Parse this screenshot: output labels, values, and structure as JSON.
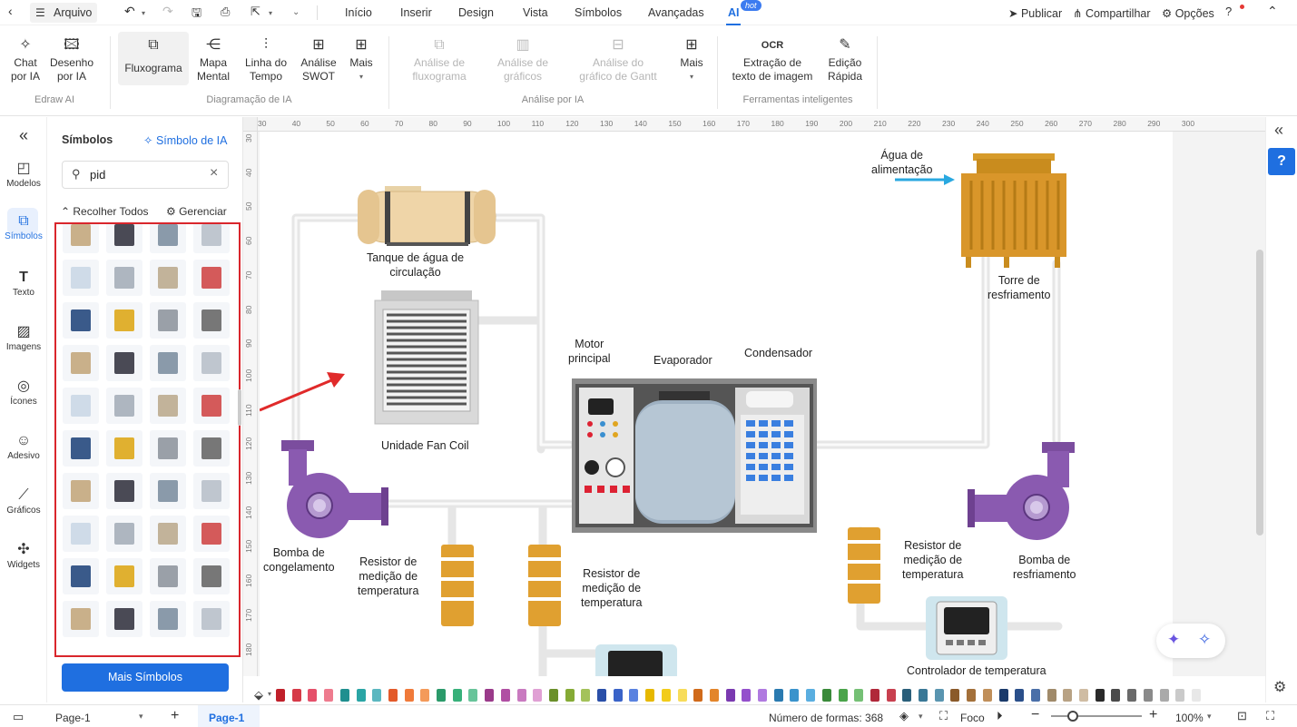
{
  "menubar": {
    "file": "Arquivo",
    "tabs": [
      "Início",
      "Inserir",
      "Design",
      "Vista",
      "Símbolos",
      "Avançadas"
    ],
    "ai_tab": "AI",
    "hot": "hot",
    "publish": "Publicar",
    "share": "Compartilhar",
    "options": "Opções"
  },
  "ribbon": {
    "chat": "Chat\npor IA",
    "drawing": "Desenho\npor IA",
    "flowchart": "Fluxograma",
    "mindmap": "Mapa\nMental",
    "timeline": "Linha do\nTempo",
    "swot": "Análise\nSWOT",
    "more1": "Mais",
    "an_flow": "Análise de\nfluxograma",
    "an_chart": "Análise de\ngráficos",
    "an_gantt": "Análise do\ngráfico de Gantt",
    "more2": "Mais",
    "ocr": "Extração de\ntexto de imagem",
    "quick_edit": "Edição\nRápida",
    "groups": [
      "Edraw AI",
      "Diagramação de IA",
      "Análise por IA",
      "Ferramentas inteligentes"
    ]
  },
  "leftnav": [
    "Modelos",
    "Símbolos",
    "Texto",
    "Imagens",
    "Ícones",
    "Adesivo",
    "Gráficos",
    "Widgets"
  ],
  "panel": {
    "title": "Símbolos",
    "ai_symbol": "Símbolo de IA",
    "search_value": "pid",
    "collapse": "Recolher Todos",
    "manage": "Gerenciar",
    "more_symbols": "Mais Símbolos"
  },
  "ruler": {
    "h": [
      "30",
      "40",
      "50",
      "60",
      "70",
      "80",
      "90",
      "100",
      "110",
      "120",
      "130",
      "140",
      "150",
      "160",
      "170",
      "180",
      "190",
      "200",
      "210",
      "220",
      "230",
      "240",
      "250",
      "260",
      "270",
      "280",
      "290",
      "300"
    ],
    "v": [
      "30",
      "40",
      "50",
      "60",
      "70",
      "80",
      "90",
      "100",
      "110",
      "120",
      "130",
      "140",
      "150",
      "160",
      "170",
      "180"
    ]
  },
  "diagram": {
    "tank": "Tanque de água de\ncirculação",
    "fancoil": "Unidade Fan Coil",
    "motor": "Motor\nprincipal",
    "evaporator": "Evaporador",
    "condenser": "Condensador",
    "feed": "Água de\nalimentação",
    "tower": "Torre de\nresfriamento",
    "pump_freeze": "Bomba de\ncongelamento",
    "resistor": "Resistor de\nmedição de\ntemperatura",
    "pump_cool": "Bomba de\nresfriamento",
    "controller": "Controlador de temperatura"
  },
  "colors": [
    "#c0202a",
    "#d63a48",
    "#e5506a",
    "#ee7b8e",
    "#1f8f8f",
    "#2aa5a5",
    "#5bb7c0",
    "#e35a2a",
    "#f07a3a",
    "#f49a5a",
    "#2b9a6a",
    "#37b07a",
    "#68c49a",
    "#9a3a8a",
    "#b04fa3",
    "#c97ac0",
    "#e0a0d4",
    "#6a8f2a",
    "#85aa35",
    "#a4c25a",
    "#2a4fa8",
    "#3a63c8",
    "#5a82e0",
    "#e6b800",
    "#f2cc1a",
    "#f7dc5a",
    "#d06a1a",
    "#e3852a",
    "#7a3ab0",
    "#9450cc",
    "#b07ae0",
    "#2a7ab0",
    "#3a93cc",
    "#5aaee0",
    "#3a8a3a",
    "#4aa44a",
    "#75c075",
    "#b0283a",
    "#c8404f",
    "#2a5f7a",
    "#3a7896",
    "#5a95b0",
    "#8a5a2a",
    "#a3703a",
    "#c08f5a",
    "#1a3a6a",
    "#2a4f8a",
    "#4a6fa8",
    "#a08a6a",
    "#b8a284",
    "#cfbca3",
    "#2a2a2a",
    "#4a4a4a",
    "#6a6a6a",
    "#8a8a8a",
    "#aaaaaa",
    "#cacaca",
    "#e8e8e8"
  ],
  "status": {
    "page_select": "Page-1",
    "page_tab": "Page-1",
    "shapes": "Número de formas: 368",
    "focus": "Foco",
    "zoom": "100%"
  }
}
